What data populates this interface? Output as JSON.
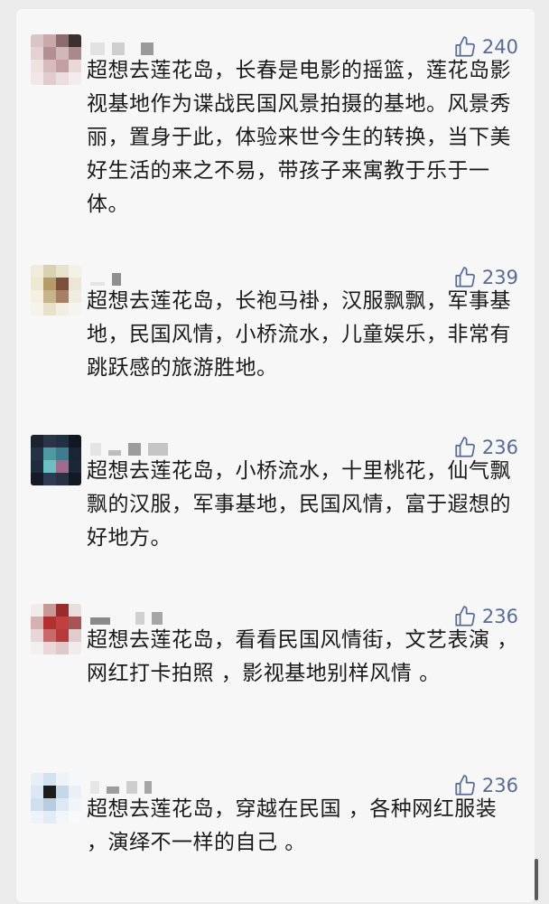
{
  "comments": [
    {
      "likes": "240",
      "text": "超想去莲花岛，长春是电影的摇篮，莲花岛影视基地作为谍战民国风景拍摄的基地。风景秀丽，置身于此，体验来世今生的转换，当下美好生活的来之不易，带孩子来寓教于乐于一体。"
    },
    {
      "likes": "239",
      "text": "超想去莲花岛，长袍马褂，汉服飘飘，军事基地，民国风情，小桥流水，儿童娱乐，非常有跳跃感的旅游胜地。"
    },
    {
      "likes": "236",
      "text": "超想去莲花岛，小桥流水，十里桃花，仙气飘飘的汉服，军事基地，民国风情，富于遐想的好地方。"
    },
    {
      "likes": "236",
      "text": "超想去莲花岛，看看民国风情街，文艺表演 ，网红打卡拍照 ，影视基地别样风情 。"
    },
    {
      "likes": "236",
      "text": "超想去莲花岛，穿越在民国 ，各种网红服装 ，演绎不一样的自己 。"
    }
  ],
  "colors": {
    "like_blue": "#576b95",
    "text": "#1a1a1a",
    "background": "#f7f7f7"
  },
  "icons": {
    "like": "thumbs-up-icon"
  }
}
